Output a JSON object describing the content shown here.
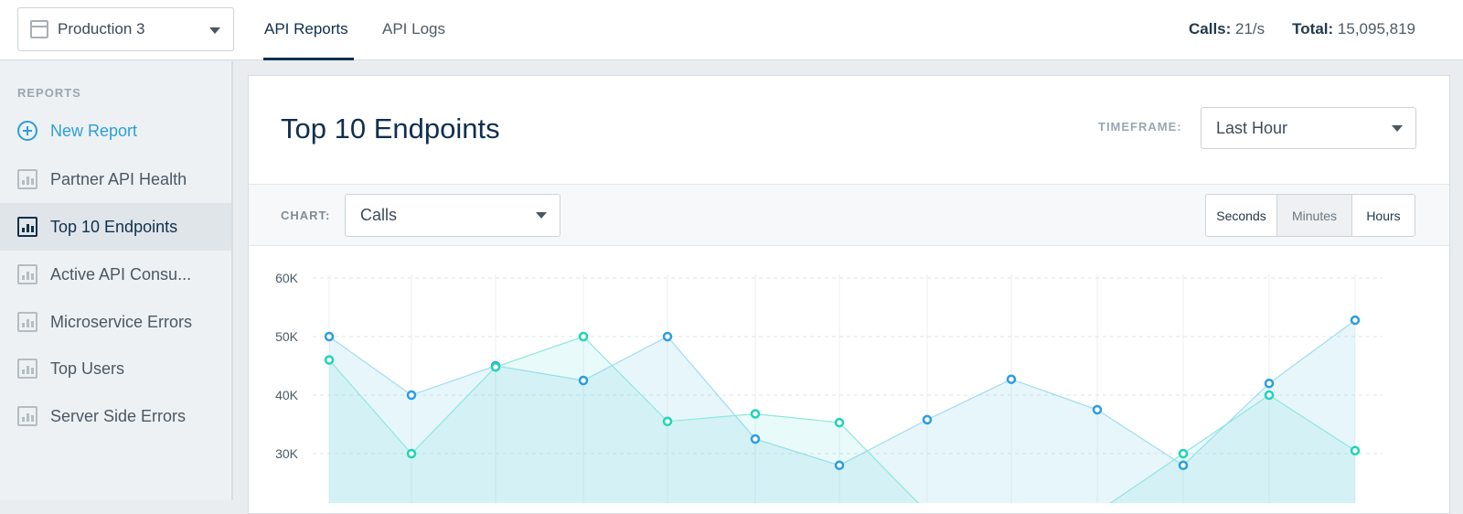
{
  "header": {
    "env_select": "Production 3",
    "tabs": [
      {
        "label": "API Reports",
        "active": true
      },
      {
        "label": "API Logs",
        "active": false
      }
    ],
    "calls_label": "Calls:",
    "calls_value": "21/s",
    "total_label": "Total:",
    "total_value": "15,095,819"
  },
  "sidebar": {
    "heading": "REPORTS",
    "new_report": "New Report",
    "items": [
      {
        "label": "Partner API Health",
        "active": false
      },
      {
        "label": "Top 10 Endpoints",
        "active": true
      },
      {
        "label": "Active API Consu...",
        "active": false
      },
      {
        "label": "Microservice Errors",
        "active": false
      },
      {
        "label": "Top Users",
        "active": false
      },
      {
        "label": "Server Side Errors",
        "active": false
      }
    ]
  },
  "report": {
    "title": "Top 10 Endpoints",
    "timeframe_label": "TIMEFRAME:",
    "timeframe_value": "Last Hour",
    "chart_label": "CHART:",
    "chart_value": "Calls",
    "granularity": [
      {
        "label": "Seconds",
        "active": false
      },
      {
        "label": "Minutes",
        "active": true
      },
      {
        "label": "Hours",
        "active": false
      }
    ]
  },
  "colors": {
    "accent": "#2b9fd9",
    "navy": "#0f2f4e",
    "series_blue": "#2a9de2",
    "series_teal": "#1fd4b8"
  },
  "chart_data": {
    "type": "area",
    "yticks": [
      "60K",
      "50K",
      "40K",
      "30K"
    ],
    "ylim": [
      20000,
      60000
    ],
    "grid": true,
    "x": [
      1,
      2,
      3,
      4,
      5,
      6,
      7,
      8,
      9,
      10,
      11,
      12,
      13
    ],
    "series": [
      {
        "values": [
          50000,
          40000,
          45000,
          42500,
          50000,
          32500,
          28000,
          35800,
          42700,
          37500,
          28000,
          42000,
          52800
        ]
      },
      {
        "values": [
          46000,
          30000,
          44800,
          50000,
          35500,
          36800,
          35300,
          20000,
          20000,
          20000,
          30000,
          40000,
          30500
        ]
      }
    ]
  }
}
